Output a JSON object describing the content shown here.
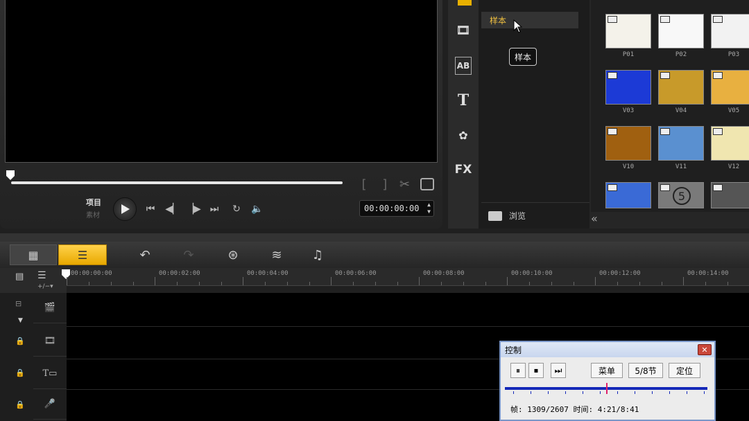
{
  "preview": {
    "project_label": "项目",
    "clip_label": "素材",
    "timecode": "00:00:00:00",
    "bracket_in": "[",
    "bracket_out": "]"
  },
  "library": {
    "sample_item": "样本",
    "tooltip": "样本",
    "browse_label": "浏览",
    "icons": [
      "media-icon",
      "transition-icon",
      "title-icon",
      "graphics-icon",
      "filter-icon"
    ],
    "thumbs": [
      {
        "label": "P01",
        "color": "#f4f2ea"
      },
      {
        "label": "P02",
        "color": "#f8f8f8"
      },
      {
        "label": "P03",
        "color": "#f2f2f2"
      },
      {
        "label": "V03",
        "color": "#1c3ad6"
      },
      {
        "label": "V04",
        "color": "#c89a2a"
      },
      {
        "label": "V05",
        "color": "#e8b040"
      },
      {
        "label": "V10",
        "color": "#a06010"
      },
      {
        "label": "V11",
        "color": "#5a90d0"
      },
      {
        "label": "V12",
        "color": "#f0e6b0"
      },
      {
        "label": "",
        "color": "#3a6ad6"
      },
      {
        "label": "",
        "color": "#7a7a7a"
      },
      {
        "label": "",
        "color": "#555555"
      }
    ],
    "countdown_digit": "5"
  },
  "ruler": {
    "labels": [
      "00:00:00:00",
      "00:00:02:00",
      "00:00:04:00",
      "00:00:06:00",
      "00:00:08:00",
      "00:00:10:00",
      "00:00:12:00",
      "00:00:14:00"
    ]
  },
  "control": {
    "title": "控制",
    "menu_label": "菜单",
    "section_label": "5/8节",
    "locate_label": "定位",
    "status": "帧: 1309/2607 时间: 4:21/8:41"
  }
}
